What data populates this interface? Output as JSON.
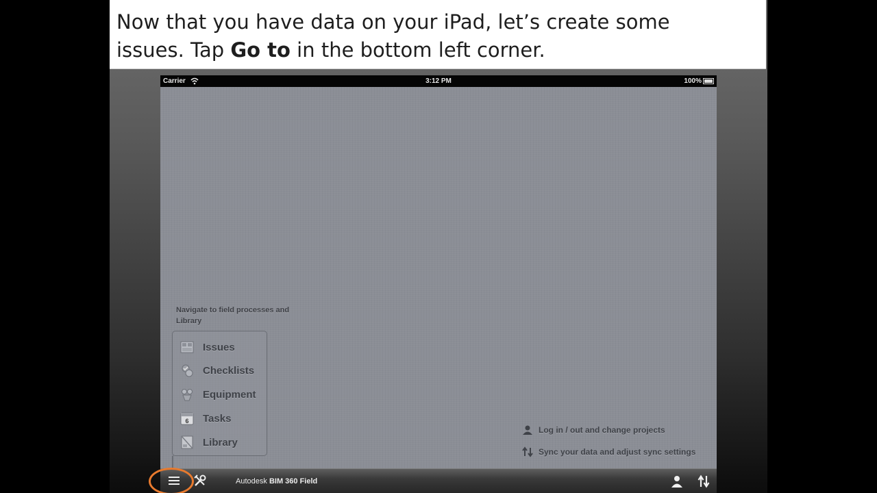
{
  "caption": {
    "line1": "Now that you have data on your iPad, let’s create some",
    "line2_prefix": "issues. Tap ",
    "line2_bold": "Go to",
    "line2_suffix": " in the bottom left corner."
  },
  "status_bar": {
    "carrier": "Carrier",
    "time": "3:12 PM",
    "battery": "100%"
  },
  "hint": {
    "title": "Navigate to field processes and Library"
  },
  "menu": {
    "items": [
      {
        "label": "Issues",
        "icon": "issues-icon"
      },
      {
        "label": "Checklists",
        "icon": "checklists-icon"
      },
      {
        "label": "Equipment",
        "icon": "equipment-icon"
      },
      {
        "label": "Tasks",
        "icon": "tasks-icon"
      },
      {
        "label": "Library",
        "icon": "library-icon"
      }
    ],
    "tasks_badge": "6"
  },
  "right_hints": {
    "login": "Log in / out and change projects",
    "sync": "Sync your data and adjust sync settings"
  },
  "toolbar": {
    "brand_prefix": "Autodesk",
    "brand_name": "BIM 360",
    "brand_suffix": "Field"
  },
  "colors": {
    "highlight": "#e87a2e",
    "screen_bg": "#8b8e96"
  }
}
